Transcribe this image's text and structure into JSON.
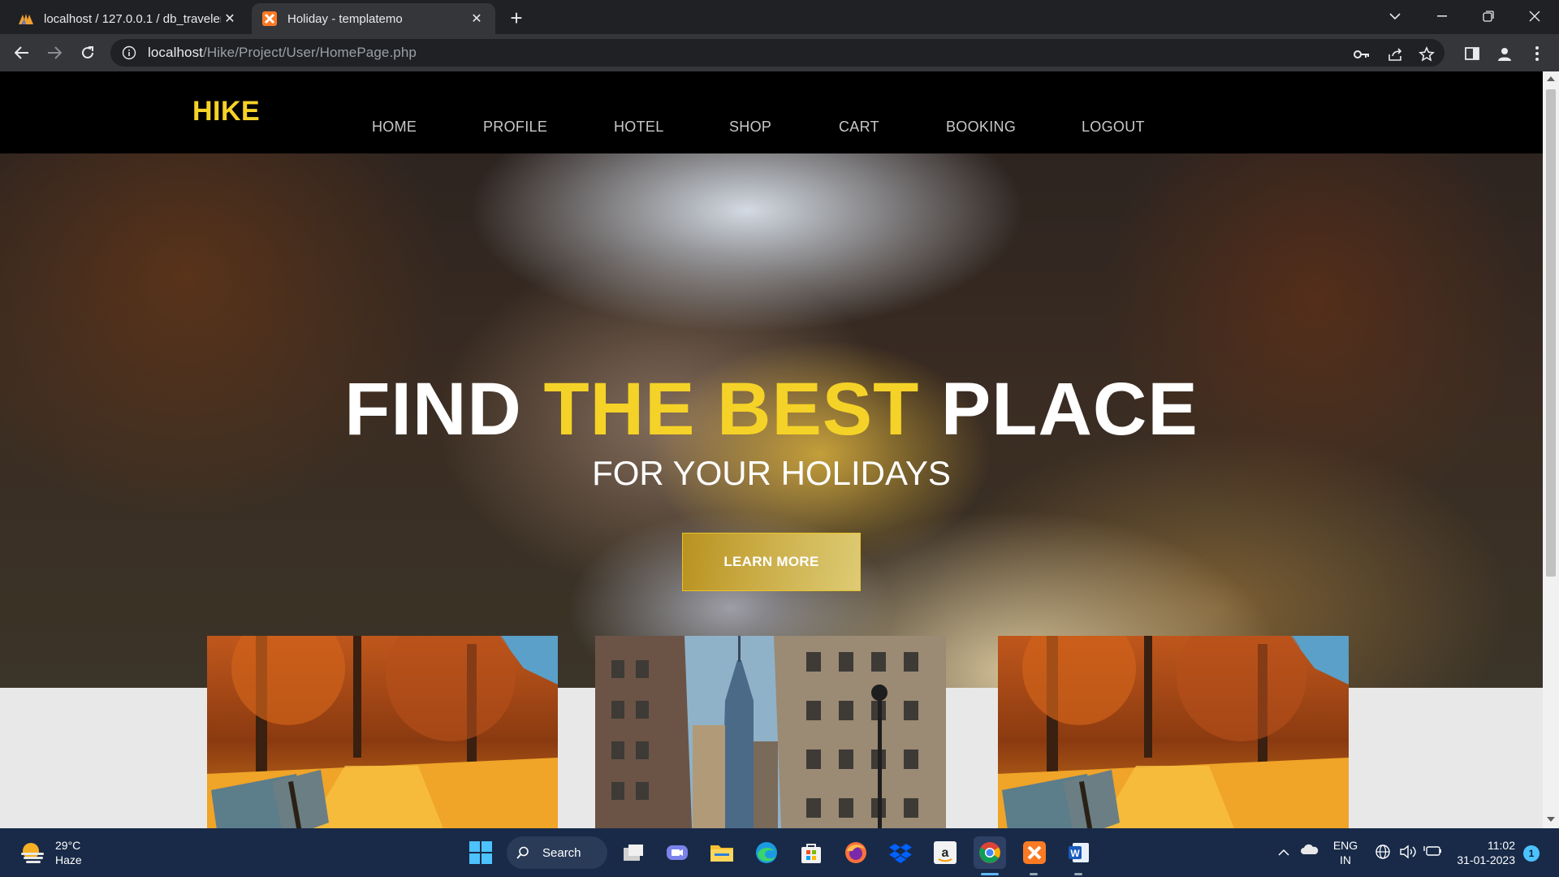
{
  "browser": {
    "tabs": [
      {
        "title": "localhost / 127.0.0.1 / db_traveler",
        "icon": "phpmyadmin-icon",
        "active": false
      },
      {
        "title": "Holiday - templatemo",
        "icon": "xampp-icon",
        "active": true
      }
    ],
    "url_host": "localhost",
    "url_path": "/Hike/Project/User/HomePage.php"
  },
  "site": {
    "logo": "HIKE",
    "nav": [
      "HOME",
      "PROFILE",
      "HOTEL",
      "SHOP",
      "CART",
      "BOOKING",
      "LOGOUT"
    ],
    "hero": {
      "title_part1": "FIND ",
      "title_highlight": "THE BEST",
      "title_part2": " PLACE",
      "subtitle": "FOR YOUR HOLIDAYS",
      "button": "LEARN MORE"
    },
    "cards": [
      {
        "image": "autumn-park-bench"
      },
      {
        "image": "city-skyscrapers"
      },
      {
        "image": "autumn-park-bench"
      }
    ],
    "accent_color": "#f5d227"
  },
  "taskbar": {
    "weather_temp": "29°C",
    "weather_desc": "Haze",
    "search_label": "Search",
    "lang_line1": "ENG",
    "lang_line2": "IN",
    "time": "11:02",
    "date": "31-01-2023",
    "notification_count": "1"
  }
}
